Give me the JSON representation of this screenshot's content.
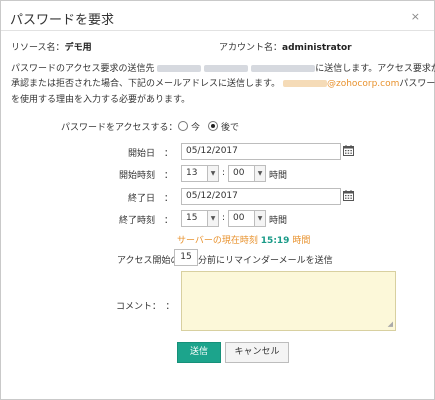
{
  "dialog": {
    "title": "パスワードを要求",
    "close": "×"
  },
  "info": {
    "resource_label": "リソース名：",
    "resource_value": "デモ用",
    "account_label": "アカウント名：",
    "account_value": "administrator"
  },
  "description": {
    "line1_a": "パスワードのアクセス要求の送信先",
    "line1_b": "に送信します。アクセス要求が",
    "line2_a": "承認または拒否された場合、下記のメールアドレスに送信します。",
    "email_domain": "@zohocorp.com",
    "line2_b": "パスワード",
    "line3": "を使用する理由を入力する必要があります。"
  },
  "access": {
    "label": "パスワードをアクセスする：",
    "option_now": "今",
    "option_later": "後で",
    "selected": "later"
  },
  "start_date": {
    "label": "開始日　：",
    "value": "05/12/2017"
  },
  "start_time": {
    "label": "開始時刻　：",
    "hour": "13",
    "minute": "00",
    "sep": ":",
    "unit": "時間"
  },
  "end_date": {
    "label": "終了日　：",
    "value": "05/12/2017"
  },
  "end_time": {
    "label": "終了時刻　：",
    "hour": "15",
    "minute": "00",
    "sep": ":",
    "unit": "時間"
  },
  "server_time": {
    "label": "サーバーの現在時刻",
    "value": "15:19",
    "unit": "時間"
  },
  "reminder": {
    "prefix": "アクセス開始の",
    "value": "15",
    "suffix": "分前にリマインダーメールを送信"
  },
  "comment": {
    "label": "コメント：　："
  },
  "buttons": {
    "send": "送信",
    "cancel": "キャンセル"
  },
  "colors": {
    "primary": "#1ca48c",
    "accent": "#e8922e",
    "comment_bg": "#fcf8d9"
  }
}
